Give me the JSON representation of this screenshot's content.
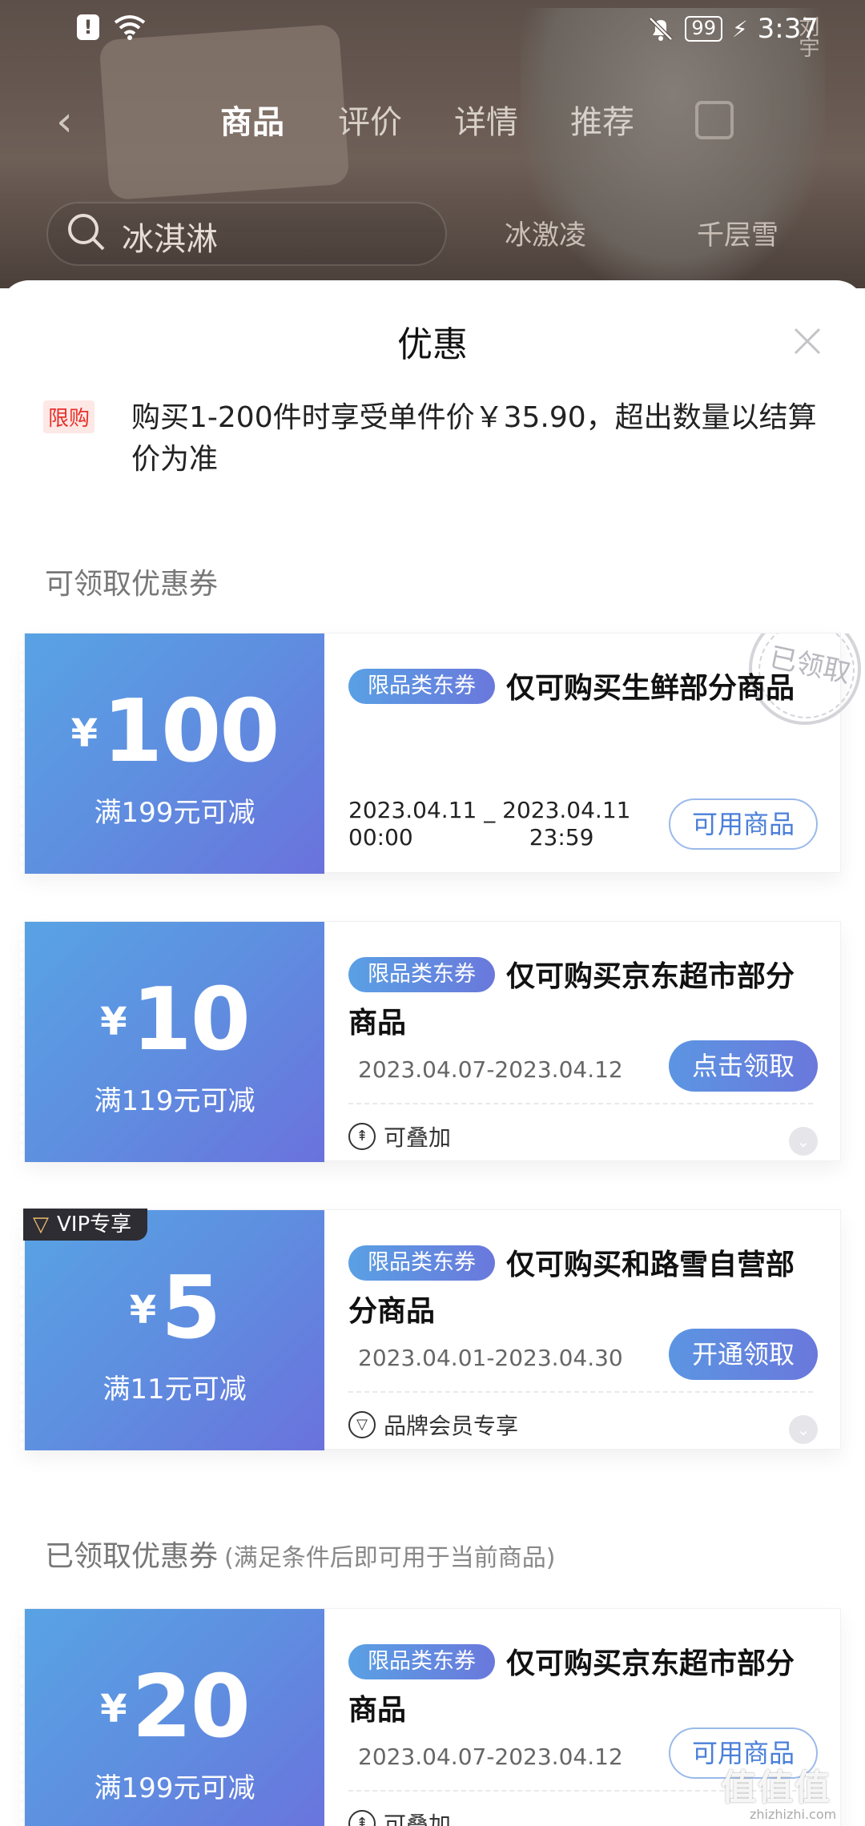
{
  "status_bar": {
    "time": "3:37",
    "battery": "99",
    "alert_glyph": "!"
  },
  "nav": {
    "tabs": [
      "商品",
      "评价",
      "详情",
      "推荐"
    ],
    "active_index": 0
  },
  "search": {
    "text": "冰淇淋",
    "chips": [
      "冰激凌",
      "千层雪"
    ]
  },
  "sheet": {
    "title": "优惠",
    "limit_badge": "限购",
    "limit_text": "购买1-200件时享受单件价￥35.90，超出数量以结算价为准",
    "section_available": "可领取优惠券",
    "section_claimed": "已领取优惠券",
    "section_claimed_note": "(满足条件后即可用于当前商品)"
  },
  "coupons": [
    {
      "currency": "¥",
      "amount": "100",
      "condition": "满199元可减",
      "tag": "限品类东券",
      "title": "仅可购买生鲜部分商品",
      "date_start": "2023.04.11",
      "time_start": "00:00",
      "date_sep": "_",
      "date_end": "2023.04.11",
      "time_end": "23:59",
      "button": "可用商品",
      "stamp": "已领取"
    },
    {
      "currency": "¥",
      "amount": "10",
      "condition": "满119元可减",
      "tag": "限品类东券",
      "title": "仅可购买京东超市部分商品",
      "date_range": "2023.04.07-2023.04.12",
      "button": "点击领取",
      "footer": "可叠加"
    },
    {
      "currency": "¥",
      "amount": "5",
      "condition": "满11元可减",
      "tag": "限品类东券",
      "title": "仅可购买和路雪自营部分商品",
      "date_range": "2023.04.01-2023.04.30",
      "button": "开通领取",
      "footer": "品牌会员专享",
      "vip": "VIP专享"
    },
    {
      "currency": "¥",
      "amount": "20",
      "condition": "满199元可减",
      "tag": "限品类东券",
      "title": "仅可购买京东超市部分商品",
      "date_range": "2023.04.07-2023.04.12",
      "button": "可用商品",
      "footer": "可叠加"
    }
  ],
  "background": {
    "vertical_text": "刘宇"
  },
  "watermark": {
    "text": "值值值",
    "url": "zhizhizhi.com"
  },
  "colors": {
    "coupon_gradient_start": "#58a3e4",
    "coupon_gradient_end": "#6a72dc",
    "limit_red": "#e8302a"
  }
}
